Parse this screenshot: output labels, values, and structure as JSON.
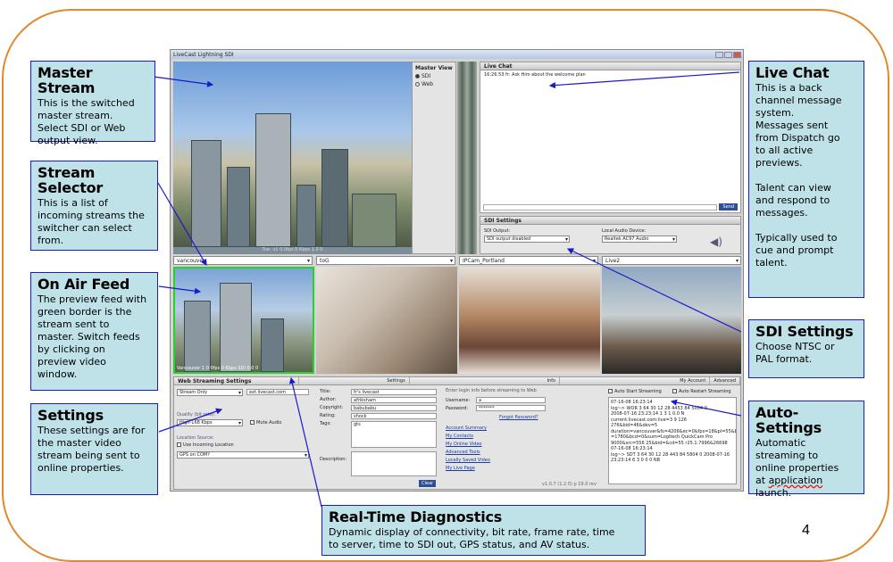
{
  "app": {
    "title": "LiveCast Lightning SDI",
    "status_text": "Tue: v1 0.0fps  0 Kbps  1.0 0",
    "master_view": {
      "title": "Master View",
      "options": [
        "SDI",
        "Web"
      ],
      "selected": "SDI"
    },
    "live_chat": {
      "title": "Live Chat",
      "message": "16:26:53 fr: Ask Him about the welcome plan",
      "send_label": "Send"
    },
    "sdi_settings": {
      "title": "SDI Settings",
      "output_label": "SDI Output:",
      "output_value": "SDI output disabled",
      "audio_label": "Local Audio Device:",
      "audio_value": "Realtek AC97 Audio"
    },
    "stream_selectors": [
      "vancouver",
      "toG",
      "IPCam_Portland",
      "Live2"
    ],
    "feed_caption": "Vancouver 1 0 0fps 0 Kbps  SDI 0.0 0",
    "web_settings": {
      "tabs": [
        "Web Streaming Settings",
        "Settings",
        "Info",
        "My Account",
        "Advanced"
      ],
      "mode": "Stream Only",
      "server": "ext.livecast.com",
      "quality_label": "Quality (bit rate):",
      "quality_value": "High-168 Kbps",
      "mute_label": "Mute Audio",
      "location_label": "Location Source:",
      "location_check": "Use Incoming Location",
      "location_value": "GPS on COM?"
    },
    "info": {
      "fields": [
        {
          "label": "Title:",
          "value": "fr's livecast"
        },
        {
          "label": "Author:",
          "value": "afriksham"
        },
        {
          "label": "Copyright:",
          "value": "babubabu"
        },
        {
          "label": "Rating:",
          "value": "shock"
        },
        {
          "label": "Tags:",
          "value": "gts"
        }
      ],
      "description_label": "Description:",
      "clear_label": "Clear"
    },
    "account": {
      "prompt": "Enter login info before streaming to Web",
      "username_label": "Username:",
      "username_value": "a",
      "password_label": "Password:",
      "password_value": "*******",
      "forgot": "Forgot Password?",
      "links": [
        "Account Summary",
        "My Contacts",
        "My Online Video",
        "Advanced Tools",
        "Locally Saved Video",
        "My Live Page"
      ],
      "version": "v1.0.7 (1.2 0) p 19.0 rev"
    },
    "advanced": {
      "auto_start": "Auto Start Streaming",
      "auto_restart": "Auto Restart Streaming",
      "diagnostics": "07-16-08 16:23:14\nlog~> WOR 3 64 30 12 28 4453 84 5004 0\n2008-07-16 23:23:14 1 3 1 0.0 N\ncurrent:livecast.com:live=3 9 126 276&bid=46&dev=5\nduration=vancouver&fs=4206&ec=0&fps=18&pl=55&br=0\n=1780&bcd=0&sum=Logitech QuickCam Pro 9000&src=556 25&bid=&cd=55 r25.1.7996&26698\n07-16-08 16:23:14\nlog~> SDT 3 64 30 12 28 443 84 5804 0 2008-07-16 23:23:14 6 3 0 0 0 NB"
    }
  },
  "callouts": {
    "master_stream": {
      "title": "Master Stream",
      "body": "This is the switched\nmaster stream.\nSelect SDI or Web\noutput view."
    },
    "stream_selector": {
      "title": "Stream Selector",
      "body": "This is a list of\nincoming streams the\nswitcher can select\nfrom."
    },
    "on_air_feed": {
      "title": "On Air Feed",
      "body": "The preview feed with\ngreen border is the\nstream sent to\nmaster.  Switch feeds\nby clicking on\npreview video\nwindow."
    },
    "settings": {
      "title": "Settings",
      "body": "These settings are for\nthe master video\nstream being sent to\nonline properties."
    },
    "live_chat": {
      "title": "Live Chat",
      "body": "This is a back\nchannel message\nsystem.\nMessages sent\nfrom Dispatch go\nto all active\npreviews.\n\nTalent can view\nand respond to\nmessages.\n\nTypically used to\ncue and prompt\ntalent."
    },
    "sdi_settings": {
      "title": "SDI Settings",
      "body": "Choose NTSC or\nPAL format."
    },
    "auto_settings": {
      "title": "Auto-Settings",
      "body_pre": "Automatic\nstreaming to\nonline properties\nat ",
      "body_spell": "application",
      "body_post": "\nlaunch."
    },
    "diagnostics": {
      "title": "Real-Time Diagnostics",
      "body": "Dynamic display of connectivity, bit rate, frame rate, time\nto server, time to SDI out, GPS status, and AV status."
    }
  },
  "page_number": "4",
  "colors": {
    "frame": "#e08a2c",
    "callout_bg": "#bfe2e8",
    "callout_border": "#1a1ac8",
    "on_air_border": "#2bd12b"
  }
}
